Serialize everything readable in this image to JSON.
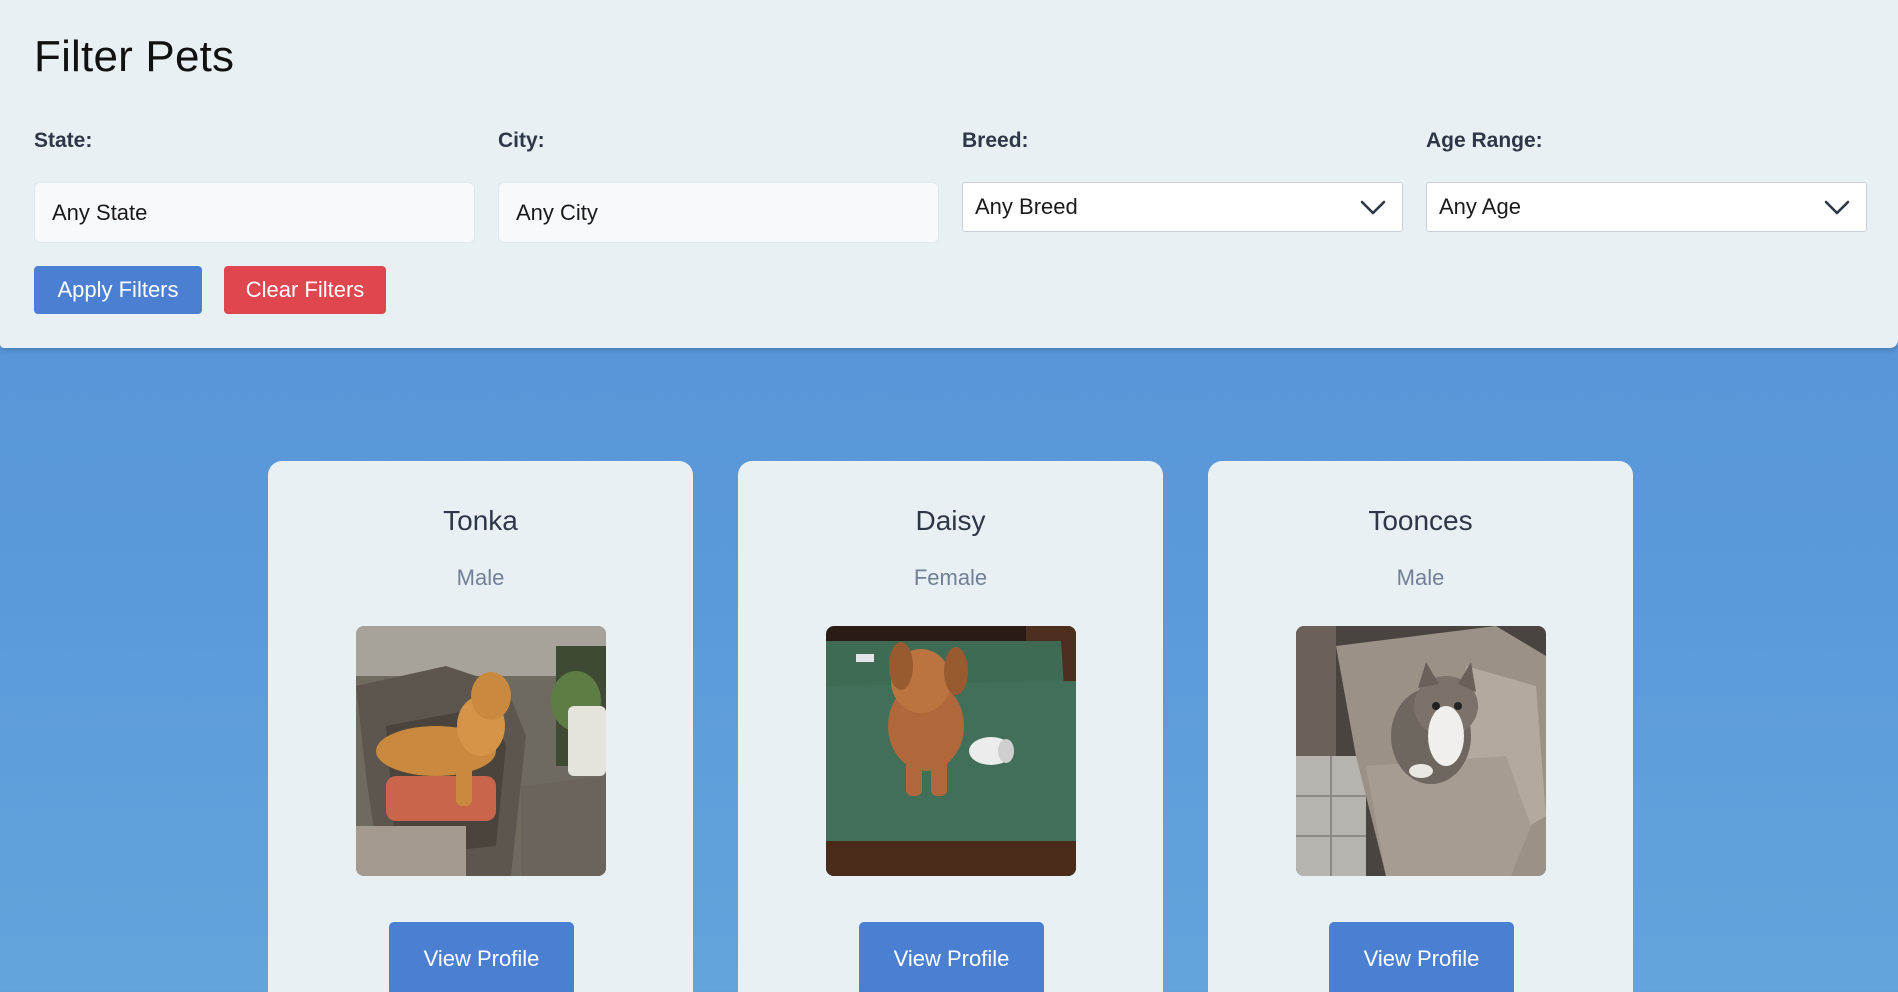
{
  "filters": {
    "title": "Filter Pets",
    "state": {
      "label": "State:",
      "placeholder": "Any State"
    },
    "city": {
      "label": "City:",
      "placeholder": "Any City"
    },
    "breed": {
      "label": "Breed:",
      "selected": "Any Breed"
    },
    "age": {
      "label": "Age Range:",
      "selected": "Any Age"
    },
    "apply_label": "Apply Filters",
    "clear_label": "Clear Filters"
  },
  "pets": [
    {
      "name": "Tonka",
      "gender": "Male",
      "button_label": "View Profile",
      "photo_icon": "dog-on-chair-photo"
    },
    {
      "name": "Daisy",
      "gender": "Female",
      "button_label": "View Profile",
      "photo_icon": "dog-on-mat-photo"
    },
    {
      "name": "Toonces",
      "gender": "Male",
      "button_label": "View Profile",
      "photo_icon": "cat-on-couch-photo"
    }
  ],
  "colors": {
    "panel_bg": "#e8f0f4",
    "page_bg": "#5490d8",
    "primary": "#4a7fd2",
    "danger": "#e0464d"
  }
}
